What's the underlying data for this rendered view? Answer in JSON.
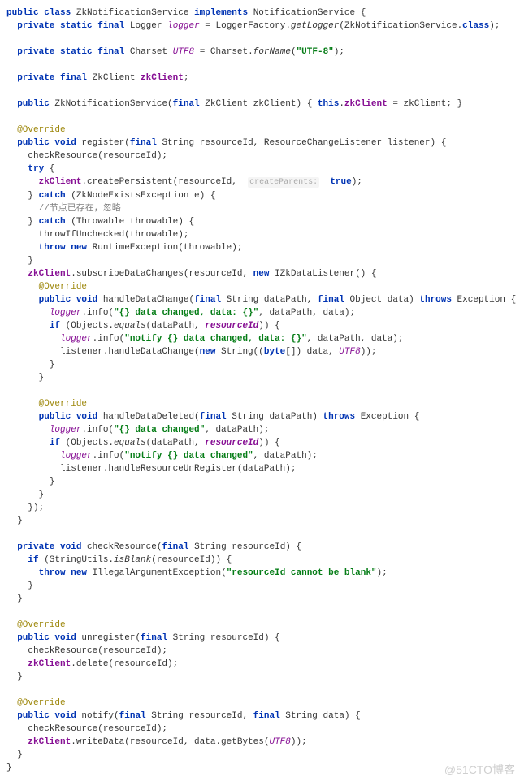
{
  "code": {
    "class_decl": {
      "public": "public",
      "class_kw": "class",
      "name": "ZkNotificationService",
      "implements_kw": "implements",
      "iface": "NotificationService",
      "open": "{"
    },
    "logger_line": {
      "private": "private",
      "static": "static",
      "final": "final",
      "type": "Logger",
      "name": "logger",
      "eq": " = LoggerFactory.",
      "call": "getLogger",
      "arg": "(ZkNotificationService.",
      "class_kw": "class",
      "end": ");"
    },
    "utf8_line": {
      "private": "private",
      "static": "static",
      "final": "final",
      "type": "Charset",
      "name": "UTF8",
      "eq": " = Charset.",
      "call": "forName",
      "open": "(",
      "str": "\"UTF-8\"",
      "end": ");"
    },
    "zkclient_field": {
      "private": "private",
      "final": "final",
      "type": "ZkClient",
      "name": "zkClient",
      "end": ";"
    },
    "ctor": {
      "public": "public",
      "name": "ZkNotificationService(",
      "final": "final",
      "ptype": " ZkClient zkClient) ",
      "open": "{ ",
      "this": "this",
      "dot": ".",
      "field": "zkClient",
      "assign": " = zkClient; ",
      "close": "}"
    },
    "override": "@Override",
    "register": {
      "sig1": "public",
      "sig2": "void",
      "name": " register(",
      "final": "final",
      "rest": " String resourceId, ResourceChangeListener listener) {",
      "check": "    checkResource(resourceId);",
      "try": "try",
      "try_open": " {",
      "zk_call_pre": "      ",
      "zk_field": "zkClient",
      "zk_call": ".createPersistent(resourceId, ",
      "hint": "createParents:",
      "true": "true",
      "zk_end": ");",
      "catch1_pre": "    } ",
      "catch": "catch",
      "catch1_rest": " (ZkNodeExistsException e) {",
      "comment": "      //节点已存在，忽略",
      "catch2_rest": " (Throwable throwable) {",
      "throwif": "      throwIfUnchecked(throwable);",
      "throw": "throw",
      "new": "new",
      "rte": " RuntimeException(throwable);",
      "close_try": "    }",
      "sub_pre": "    ",
      "sub_call": ".subscribeDataChanges(resourceId, ",
      "new2": "new",
      "listener": " IZkDataListener() {"
    },
    "handleDataChange": {
      "sig_pre": "      ",
      "public": "public",
      "void": "void",
      "name": " handleDataChange(",
      "final1": "final",
      "p1": " String dataPath, ",
      "final2": "final",
      "p2": " Object data) ",
      "throws": "throws",
      "exc": " Exception {",
      "log1_pre": "        ",
      "logger": "logger",
      "log1_call": ".info(",
      "log1_str": "\"{} data changed, data: {}\"",
      "log1_rest": ", dataPath, data);",
      "if": "if",
      "if_cond_pre": " (Objects.",
      "equals": "equals",
      "if_cond_rest": "(dataPath, ",
      "resid": "resourceId",
      "if_close": ")) {",
      "log2_str": "\"notify {} data changed, data: {}\"",
      "log2_rest": ", dataPath, data);",
      "listener_call_pre": "          listener.handleDataChange(",
      "new": "new",
      "string": " String((",
      "byte": "byte",
      "arr": "[]) data, ",
      "utf8": "UTF8",
      "end": "));",
      "close1": "        }",
      "close2": "      }"
    },
    "handleDataDeleted": {
      "name": " handleDataDeleted(",
      "p1": " String dataPath) ",
      "log1_str": "\"{} data changed\"",
      "log1_rest": ", dataPath);",
      "log2_str": "\"notify {} data changed\"",
      "log2_rest": ", dataPath);",
      "listener_call": "          listener.handleResourceUnRegister(dataPath);"
    },
    "anon_close": "    });",
    "method_close": "  }",
    "checkResource": {
      "private": "private",
      "void": "void",
      "name": " checkResource(",
      "final": "final",
      "rest": " String resourceId) {",
      "if": "if",
      "cond_pre": " (StringUtils.",
      "isblank": "isBlank",
      "cond_rest": "(resourceId)) {",
      "throw": "throw",
      "new": "new",
      "exc": " IllegalArgumentException(",
      "str": "\"resourceId cannot be blank\"",
      "end": ");",
      "close1": "    }",
      "close2": "  }"
    },
    "unregister": {
      "name": " unregister(",
      "rest": " String resourceId) {",
      "check": "    checkResource(resourceId);",
      "del_pre": "    ",
      "del": ".delete(resourceId);",
      "close": "  }"
    },
    "notify": {
      "name": " notify(",
      "p1": " String resourceId, ",
      "p2": " String data) {",
      "check": "    checkResource(resourceId);",
      "write_pre": "    ",
      "write": ".writeData(resourceId, data.getBytes(",
      "utf8": "UTF8",
      "end": "));",
      "close": "  }"
    },
    "class_close": "}"
  },
  "watermark": "@51CTO博客"
}
